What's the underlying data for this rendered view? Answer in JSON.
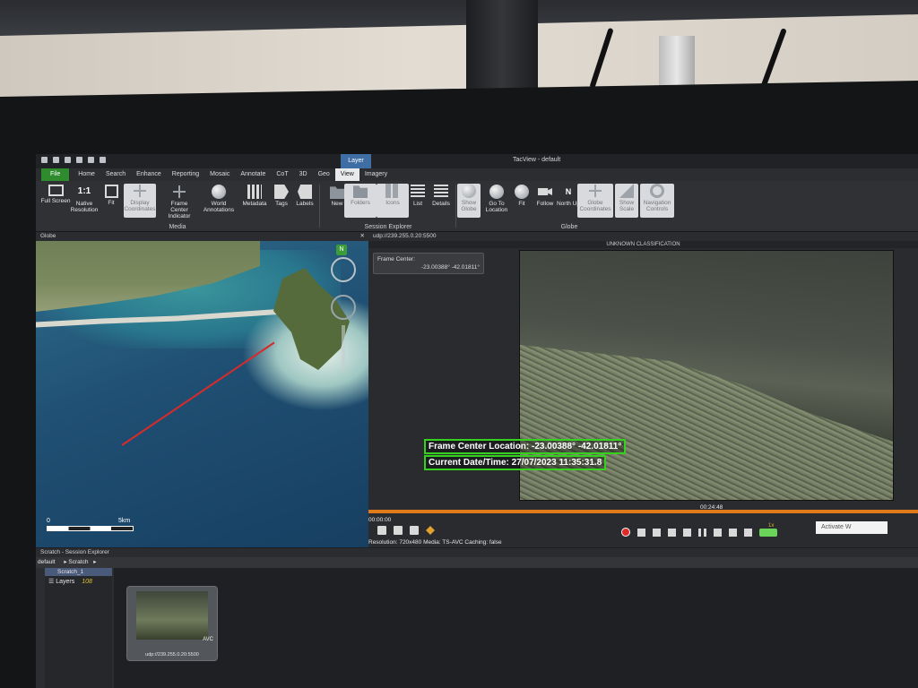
{
  "window": {
    "title": "TacView - default",
    "context_tab": "Layer"
  },
  "menu": [
    "Home",
    "Search",
    "Enhance",
    "Reporting",
    "Mosaic",
    "Annotate",
    "CoT",
    "3D",
    "Geo",
    "View",
    "Imagery"
  ],
  "menu_file": "File",
  "ribbon": {
    "media": {
      "label": "Media",
      "buttons": [
        {
          "label": "Full Screen",
          "icon": "monitor-icon"
        },
        {
          "label": "Native Resolution",
          "icon": "one-to-one-icon"
        },
        {
          "label": "Fit",
          "icon": "fit-icon"
        },
        {
          "label": "Display Coordinates",
          "icon": "crosshair-icon"
        },
        {
          "label": "Frame Center Indicator",
          "icon": "crosshair-icon"
        },
        {
          "label": "World Annotations",
          "icon": "globe-icon"
        },
        {
          "label": "Metadata",
          "icon": "film-icon"
        },
        {
          "label": "Tags",
          "icon": "tag-icon"
        },
        {
          "label": "Labels",
          "icon": "label-icon"
        }
      ]
    },
    "session": {
      "label": "Session Explorer",
      "buttons": [
        {
          "label": "New",
          "icon": "new-icon"
        },
        {
          "label": "Folders",
          "icon": "folder-icon"
        },
        {
          "label": "Icons",
          "icon": "grid-icon"
        },
        {
          "label": "List",
          "icon": "list-icon"
        },
        {
          "label": "Details",
          "icon": "details-icon"
        }
      ]
    },
    "globe": {
      "label": "Globe",
      "buttons": [
        {
          "label": "Show Globe",
          "icon": "globe-icon"
        },
        {
          "label": "Go To Location",
          "icon": "globe-icon"
        },
        {
          "label": "Fit",
          "icon": "globe-fit-icon"
        },
        {
          "label": "Follow",
          "icon": "camera-icon"
        },
        {
          "label": "North Up",
          "icon": "north-icon"
        },
        {
          "label": "Globe Coordinates",
          "icon": "crosshair-icon"
        },
        {
          "label": "Show Scale",
          "icon": "scale-icon"
        },
        {
          "label": "Navigation Controls",
          "icon": "navigation-icon"
        }
      ]
    }
  },
  "globe_panel": {
    "title": "Globe",
    "compass_label": "N",
    "scale_start": "0",
    "scale_end": "5km"
  },
  "video_panel": {
    "title": "udp://239.255.0.20:5500",
    "classification": "UNKNOWN CLASSIFICATION",
    "frame_center_title": "Frame Center:",
    "frame_center_value": "-23.00388° -42.01811°",
    "overlay_location": "Frame Center Location: -23.00388° -42.01811°",
    "overlay_datetime": "Current Date/Time: 27/07/2023 11:35:31.8",
    "time_current": "00:24:48",
    "time_start": "00:00:00",
    "speed": "1x",
    "status": "Resolution: 720x480  Media: TS-AVC  Caching: false"
  },
  "explorer": {
    "title": "Scratch - Session Explorer",
    "breadcrumb_root": "default",
    "breadcrumb_item": "Scratch",
    "tree_head": "Scratch_1",
    "layers_label": "Layers",
    "layers_count": "108",
    "item_badge": "AVC",
    "item_name": "udp://239.255.0.20:5500"
  },
  "os_notice": "Activate W"
}
